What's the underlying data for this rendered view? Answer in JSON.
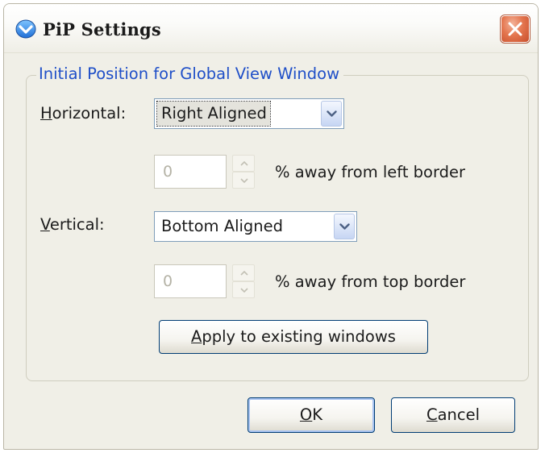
{
  "window": {
    "title": "PiP Settings",
    "close_icon": "close-icon",
    "app_icon": "shield-chevron-icon"
  },
  "group": {
    "legend": "Initial Position for Global View Window"
  },
  "horizontal": {
    "label_mnemonic": "H",
    "label_rest": "orizontal:",
    "selected": "Right Aligned",
    "offset_value": "0",
    "offset_label": "% away from left border"
  },
  "vertical": {
    "label_mnemonic": "V",
    "label_rest": "ertical:",
    "selected": "Bottom Aligned",
    "offset_value": "0",
    "offset_label": "% away from top border"
  },
  "apply_button": {
    "mnemonic": "A",
    "rest": "pply to existing windows"
  },
  "footer": {
    "ok_mnemonic": "O",
    "ok_rest": "K",
    "cancel_mnemonic": "C",
    "cancel_rest": "ancel"
  },
  "colors": {
    "legend": "#1f4fc8",
    "close_button": "#e4764f",
    "dialog_background": "#f0efe7",
    "disabled_text": "#b5b3a6"
  }
}
